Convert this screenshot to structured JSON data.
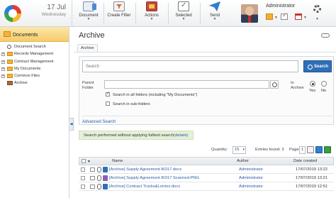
{
  "header": {
    "date_day": "17 Jul",
    "date_weekday": "Wednesday",
    "tools": [
      {
        "label": "Document"
      },
      {
        "label": "Create Filter"
      },
      {
        "label": "Actions"
      },
      {
        "label": "Selected"
      },
      {
        "label": "Send"
      }
    ],
    "user_name": "Administrator"
  },
  "sidebar": {
    "title": "Documents",
    "items": [
      {
        "label": "Document Search"
      },
      {
        "label": "Records Management"
      },
      {
        "label": "Contract Management"
      },
      {
        "label": "My Documents"
      },
      {
        "label": "Common Files"
      },
      {
        "label": "Archive"
      }
    ]
  },
  "main": {
    "title": "Archive",
    "subtab": "Archive",
    "search": {
      "placeholder": "Search",
      "button": "Search",
      "parent_folder_label": "Parent Folder",
      "opt_all_folders": "Search in all folders (including \"My Documents\")",
      "opt_sub_folders": "Search in sub-folders",
      "in_archive_label": "In Archive",
      "yes": "Yes",
      "no": "No",
      "advanced": "Advanced Search"
    },
    "notice": {
      "text": "Search performed without applying fulltext search",
      "link": "(details)"
    },
    "pager": {
      "quantity_label": "Quantity:",
      "quantity_value": "15",
      "entries_found": "Entries found: 3",
      "pages_label": "Pages:",
      "page": "1"
    },
    "grid": {
      "columns": {
        "name": "Name",
        "author": "Author",
        "date": "Date created"
      },
      "rows": [
        {
          "name": "[Archive] Supply Agreement IK017.docx",
          "author": "Administrator",
          "date": "17/07/2019 13:22"
        },
        {
          "name": "[Archive] Supply Agreement IK017 Scanned.PNG",
          "author": "Administrator",
          "date": "17/07/2019 13:21"
        },
        {
          "name": "[Archive] Contract Trucks&Lorries.docx",
          "author": "Administrator",
          "date": "17/07/2019 12:51"
        }
      ]
    }
  }
}
